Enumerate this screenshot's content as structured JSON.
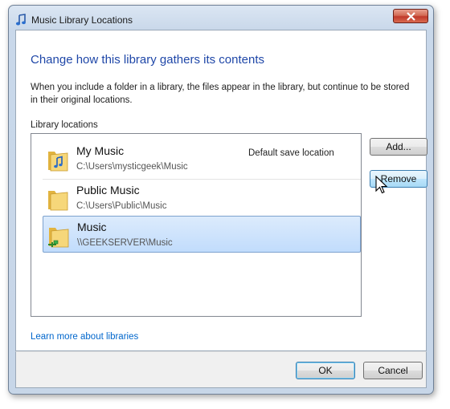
{
  "window": {
    "title": "Music Library Locations"
  },
  "heading": "Change how this library gathers its contents",
  "description": "When you include a folder in a library, the files appear in the library, but continue to be stored in their original locations.",
  "list_label": "Library locations",
  "locations": [
    {
      "name": "My Music",
      "path": "C:\\Users\\mysticgeek\\Music",
      "note": "Default save location",
      "selected": false,
      "icon": "music-folder-icon"
    },
    {
      "name": "Public Music",
      "path": "C:\\Users\\Public\\Music",
      "note": "",
      "selected": false,
      "icon": "folder-icon"
    },
    {
      "name": "Music",
      "path": "\\\\GEEKSERVER\\Music",
      "note": "",
      "selected": true,
      "icon": "network-folder-icon"
    }
  ],
  "buttons": {
    "add": "Add...",
    "remove": "Remove",
    "ok": "OK",
    "cancel": "Cancel"
  },
  "link": "Learn more about libraries",
  "colors": {
    "heading": "#1f47a8",
    "link": "#0066cc",
    "selection": "#c1dcfc"
  }
}
